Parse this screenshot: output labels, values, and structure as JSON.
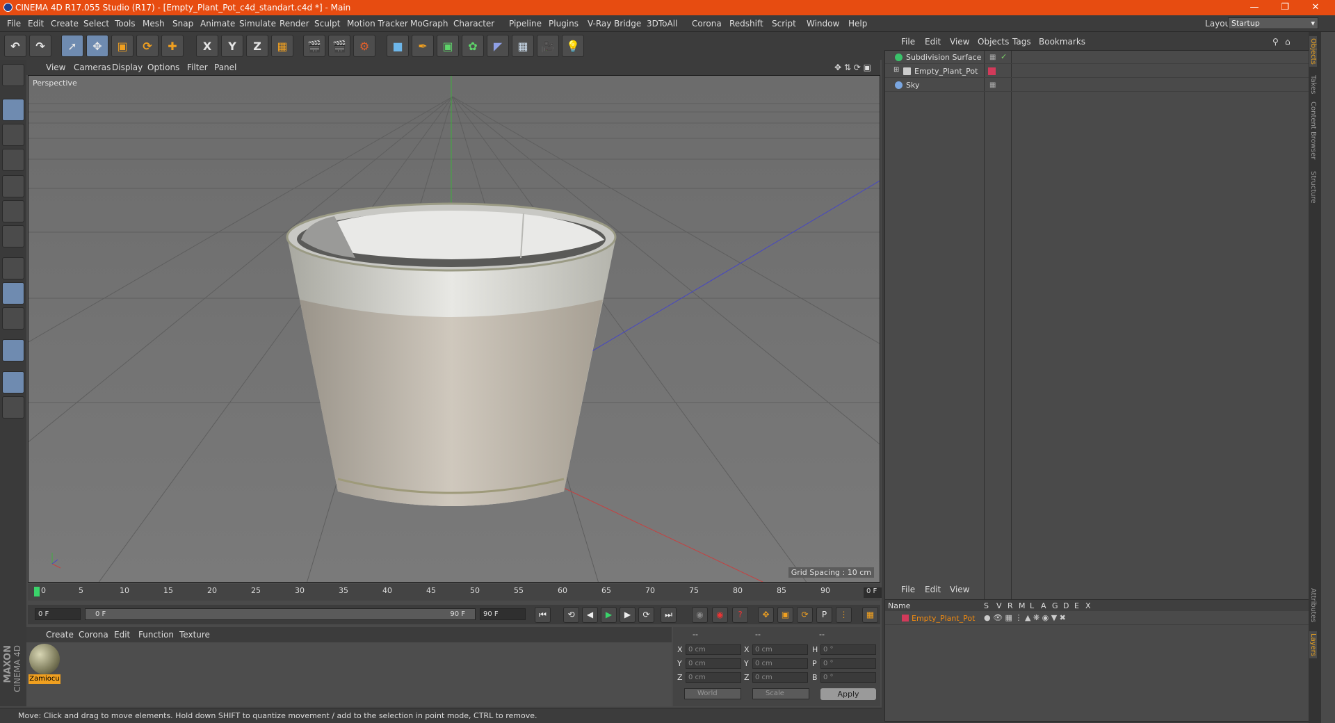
{
  "window": {
    "title": "CINEMA 4D R17.055 Studio (R17) - [Empty_Plant_Pot_c4d_standart.c4d *] - Main"
  },
  "menubar": {
    "items": [
      "File",
      "Edit",
      "Create",
      "Select",
      "Tools",
      "Mesh",
      "Snap",
      "Animate",
      "Simulate",
      "Render",
      "Sculpt",
      "Motion Tracker",
      "MoGraph",
      "Character",
      "Pipeline",
      "Plugins",
      "V-Ray Bridge",
      "3DToAll",
      "Corona",
      "Redshift",
      "Script",
      "Window",
      "Help"
    ],
    "layout_label": "Layout:",
    "layout_value": "Startup"
  },
  "toolbar": {
    "axis_x": "X",
    "axis_y": "Y",
    "axis_z": "Z"
  },
  "viewport": {
    "menu": [
      "View",
      "Cameras",
      "Display",
      "Options",
      "Filter",
      "Panel"
    ],
    "camera_label": "Perspective",
    "grid_spacing": "Grid Spacing : 10 cm"
  },
  "timeline": {
    "ticks": [
      "0",
      "5",
      "10",
      "15",
      "20",
      "25",
      "30",
      "35",
      "40",
      "45",
      "50",
      "55",
      "60",
      "65",
      "70",
      "75",
      "80",
      "85",
      "90"
    ],
    "current_frame": "0 F",
    "start_field": "0 F",
    "range_start": "0 F",
    "range_end": "90 F",
    "end_field": "90 F"
  },
  "material_manager": {
    "menu": [
      "Create",
      "Corona",
      "Edit",
      "Function",
      "Texture"
    ],
    "material_name": "Zamiocu"
  },
  "coordinates": {
    "headers": [
      "--",
      "--",
      "--"
    ],
    "pos_labels": [
      "X",
      "Y",
      "Z"
    ],
    "size_labels": [
      "X",
      "Y",
      "Z"
    ],
    "rot_labels": [
      "H",
      "P",
      "B"
    ],
    "pos_values": [
      "0 cm",
      "0 cm",
      "0 cm"
    ],
    "size_values": [
      "0 cm",
      "0 cm",
      "0 cm"
    ],
    "rot_values": [
      "0 °",
      "0 °",
      "0 °"
    ],
    "mode_world": "World",
    "mode_scale": "Scale",
    "apply": "Apply"
  },
  "status": {
    "text": "Move: Click and drag to move elements. Hold down SHIFT to quantize movement / add to the selection in point mode, CTRL to remove."
  },
  "object_manager": {
    "menu": [
      "File",
      "Edit",
      "View",
      "Objects",
      "Tags",
      "Bookmarks"
    ],
    "objects": [
      "Subdivision Surface",
      "Empty_Plant_Pot",
      "Sky"
    ]
  },
  "layer_manager": {
    "menu": [
      "File",
      "Edit",
      "View"
    ],
    "columns": [
      "Name",
      "S",
      "V",
      "R",
      "M",
      "L",
      "A",
      "G",
      "D",
      "E",
      "X"
    ],
    "layer_name": "Empty_Plant_Pot"
  },
  "side_tabs": [
    "Objects",
    "Takes",
    "Content Browser",
    "Structure",
    "Attributes",
    "Layers"
  ],
  "branding": {
    "maxon": "MAXON",
    "cinema": "CINEMA 4D"
  },
  "colors": {
    "title_bar": "#e74c11",
    "accent": "#e7a020",
    "layer_color": "#d23a5a"
  }
}
